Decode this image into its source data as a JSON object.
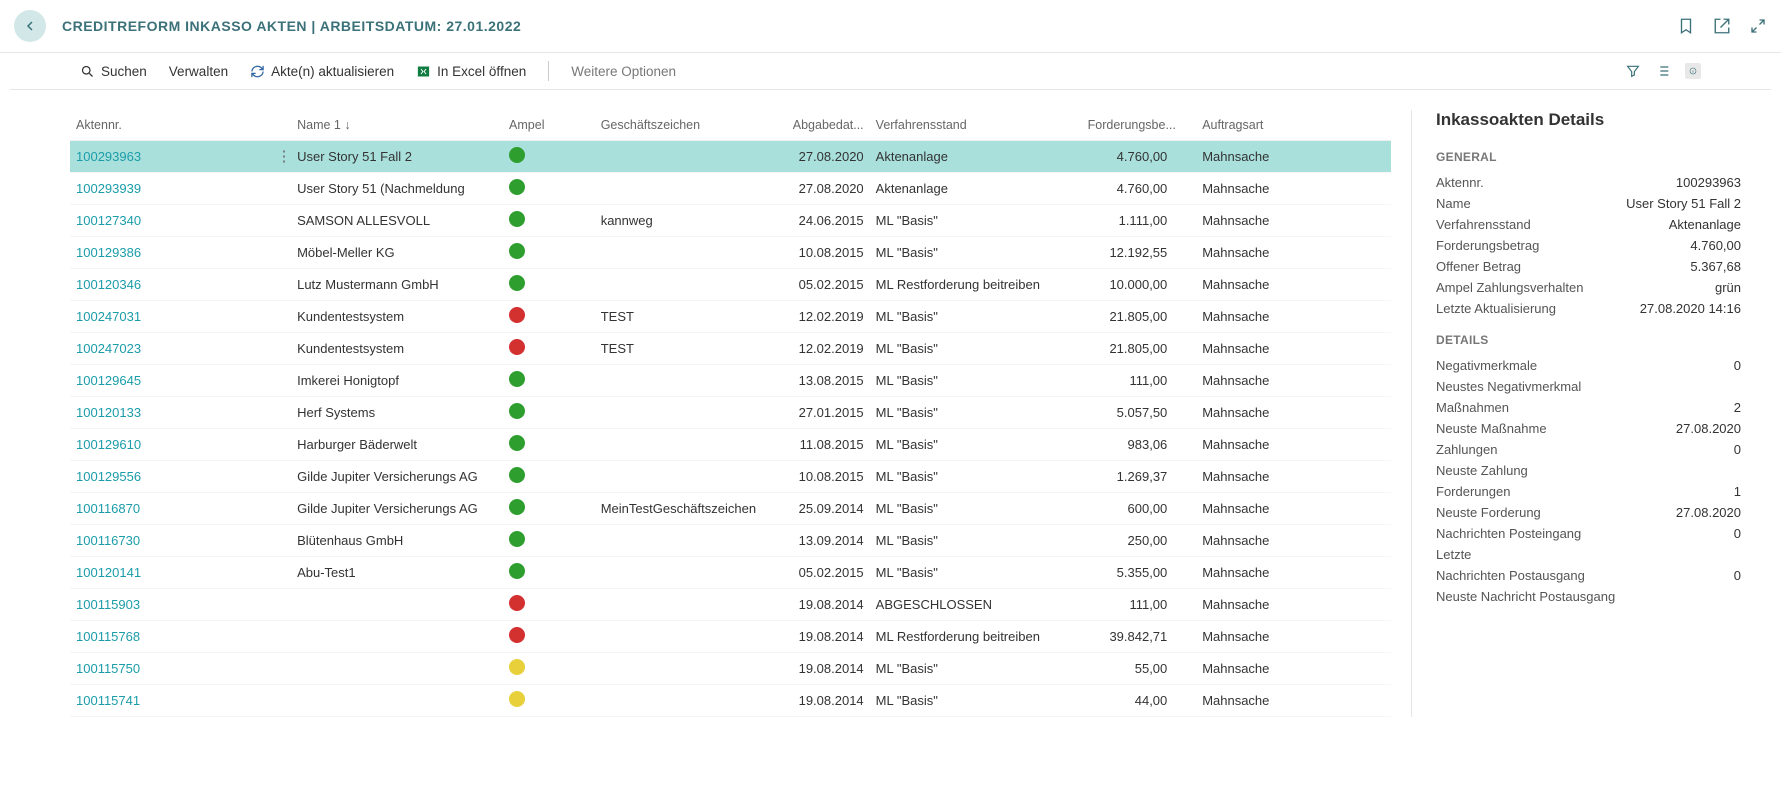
{
  "header": {
    "title": "CREDITREFORM INKASSO AKTEN | ARBEITSDATUM: 27.01.2022"
  },
  "toolbar": {
    "search": "Suchen",
    "manage": "Verwalten",
    "refresh": "Akte(n) aktualisieren",
    "excel": "In Excel öffnen",
    "moreOptions": "Weitere Optionen"
  },
  "columns": {
    "aktennr": "Aktennr.",
    "name": "Name 1 ↓",
    "ampel": "Ampel",
    "gz": "Geschäftszeichen",
    "abgabe": "Abgabedat...",
    "verfahrensstand": "Verfahrensstand",
    "forderung": "Forderungsbe...",
    "auftragsart": "Auftragsart"
  },
  "rows": [
    {
      "id": "100293963",
      "name": "User Story 51 Fall 2",
      "ampel": "green",
      "gz": "",
      "abgabe": "27.08.2020",
      "verf": "Aktenanlage",
      "ford": "4.760,00",
      "auf": "Mahnsache",
      "selected": true
    },
    {
      "id": "100293939",
      "name": "User Story 51 (Nachmeldung",
      "ampel": "green",
      "gz": "",
      "abgabe": "27.08.2020",
      "verf": "Aktenanlage",
      "ford": "4.760,00",
      "auf": "Mahnsache"
    },
    {
      "id": "100127340",
      "name": "SAMSON ALLESVOLL",
      "ampel": "green",
      "gz": "kannweg",
      "abgabe": "24.06.2015",
      "verf": "ML \"Basis\"",
      "ford": "1.111,00",
      "auf": "Mahnsache"
    },
    {
      "id": "100129386",
      "name": "Möbel-Meller KG",
      "ampel": "green",
      "gz": "",
      "abgabe": "10.08.2015",
      "verf": "ML \"Basis\"",
      "ford": "12.192,55",
      "auf": "Mahnsache"
    },
    {
      "id": "100120346",
      "name": "Lutz Mustermann GmbH",
      "ampel": "green",
      "gz": "",
      "abgabe": "05.02.2015",
      "verf": "ML Restforderung beitreiben",
      "ford": "10.000,00",
      "auf": "Mahnsache"
    },
    {
      "id": "100247031",
      "name": "Kundentestsystem",
      "ampel": "red",
      "gz": "TEST",
      "abgabe": "12.02.2019",
      "verf": "ML \"Basis\"",
      "ford": "21.805,00",
      "auf": "Mahnsache"
    },
    {
      "id": "100247023",
      "name": "Kundentestsystem",
      "ampel": "red",
      "gz": "TEST",
      "abgabe": "12.02.2019",
      "verf": "ML \"Basis\"",
      "ford": "21.805,00",
      "auf": "Mahnsache"
    },
    {
      "id": "100129645",
      "name": "Imkerei Honigtopf",
      "ampel": "green",
      "gz": "",
      "abgabe": "13.08.2015",
      "verf": "ML \"Basis\"",
      "ford": "111,00",
      "auf": "Mahnsache"
    },
    {
      "id": "100120133",
      "name": "Herf Systems",
      "ampel": "green",
      "gz": "",
      "abgabe": "27.01.2015",
      "verf": "ML \"Basis\"",
      "ford": "5.057,50",
      "auf": "Mahnsache"
    },
    {
      "id": "100129610",
      "name": "Harburger Bäderwelt",
      "ampel": "green",
      "gz": "",
      "abgabe": "11.08.2015",
      "verf": "ML \"Basis\"",
      "ford": "983,06",
      "auf": "Mahnsache"
    },
    {
      "id": "100129556",
      "name": "Gilde Jupiter Versicherungs AG",
      "ampel": "green",
      "gz": "",
      "abgabe": "10.08.2015",
      "verf": "ML \"Basis\"",
      "ford": "1.269,37",
      "auf": "Mahnsache"
    },
    {
      "id": "100116870",
      "name": "Gilde Jupiter Versicherungs AG",
      "ampel": "green",
      "gz": "MeinTestGeschäftszeichen",
      "abgabe": "25.09.2014",
      "verf": "ML \"Basis\"",
      "ford": "600,00",
      "auf": "Mahnsache"
    },
    {
      "id": "100116730",
      "name": "Blütenhaus GmbH",
      "ampel": "green",
      "gz": "",
      "abgabe": "13.09.2014",
      "verf": "ML \"Basis\"",
      "ford": "250,00",
      "auf": "Mahnsache"
    },
    {
      "id": "100120141",
      "name": "Abu-Test1",
      "ampel": "green",
      "gz": "",
      "abgabe": "05.02.2015",
      "verf": "ML \"Basis\"",
      "ford": "5.355,00",
      "auf": "Mahnsache"
    },
    {
      "id": "100115903",
      "name": "",
      "ampel": "red",
      "gz": "",
      "abgabe": "19.08.2014",
      "verf": "ABGESCHLOSSEN",
      "ford": "111,00",
      "auf": "Mahnsache"
    },
    {
      "id": "100115768",
      "name": "",
      "ampel": "red",
      "gz": "",
      "abgabe": "19.08.2014",
      "verf": "ML Restforderung beitreiben",
      "ford": "39.842,71",
      "auf": "Mahnsache"
    },
    {
      "id": "100115750",
      "name": "",
      "ampel": "yellow",
      "gz": "",
      "abgabe": "19.08.2014",
      "verf": "ML \"Basis\"",
      "ford": "55,00",
      "auf": "Mahnsache"
    },
    {
      "id": "100115741",
      "name": "",
      "ampel": "yellow",
      "gz": "",
      "abgabe": "19.08.2014",
      "verf": "ML \"Basis\"",
      "ford": "44,00",
      "auf": "Mahnsache"
    }
  ],
  "details": {
    "title": "Inkassoakten Details",
    "general_h": "GENERAL",
    "details_h": "DETAILS",
    "general": {
      "aktennr_l": "Aktennr.",
      "aktennr_v": "100293963",
      "name_l": "Name",
      "name_v": "User Story 51 Fall 2",
      "verf_l": "Verfahrensstand",
      "verf_v": "Aktenanlage",
      "ford_l": "Forderungsbetrag",
      "ford_v": "4.760,00",
      "offen_l": "Offener Betrag",
      "offen_v": "5.367,68",
      "ampel_l": "Ampel Zahlungsverhalten",
      "ampel_v": "grün",
      "akt_l": "Letzte Aktualisierung",
      "akt_v": "27.08.2020 14:16"
    },
    "items": {
      "neg_l": "Negativmerkmale",
      "neg_v": "0",
      "nneg_l": "Neustes Negativmerkmal",
      "nneg_v": "",
      "mass_l": "Maßnahmen",
      "mass_v": "2",
      "nmass_l": "Neuste Maßnahme",
      "nmass_v": "27.08.2020",
      "zahl_l": "Zahlungen",
      "zahl_v": "0",
      "nzahl_l": "Neuste Zahlung",
      "nzahl_v": "",
      "ford_l": "Forderungen",
      "ford_v": "1",
      "nford_l": "Neuste Forderung",
      "nford_v": "27.08.2020",
      "npe_l": "Nachrichten Posteingang",
      "npe_v": "0",
      "letzte_l": "Letzte",
      "letzte_v": "",
      "npa_l": "Nachrichten Postausgang",
      "npa_v": "0",
      "nnpa_l": "Neuste Nachricht Postausgang",
      "nnpa_v": ""
    }
  }
}
